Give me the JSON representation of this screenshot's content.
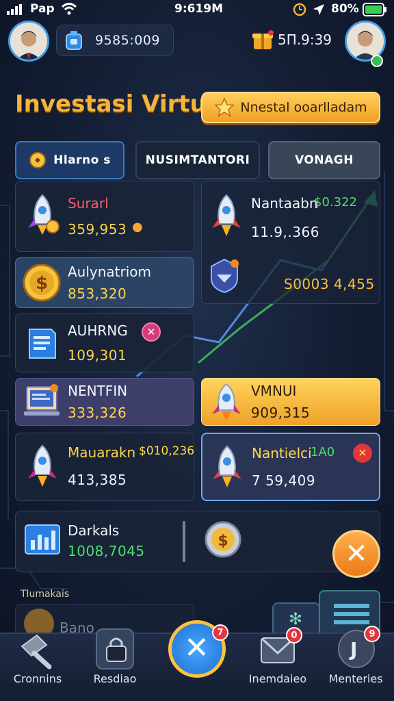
{
  "status_bar": {
    "carrier": "Pap",
    "time": "9:619M",
    "battery": "80%"
  },
  "header": {
    "balance": "9585:009",
    "timer": "5Π.9:39"
  },
  "title": "Investasi Virtual",
  "cta_label": "Nnestal ooarlladam",
  "tabs": [
    {
      "label": "Hlarno s"
    },
    {
      "label": "NUSIMTANTORI"
    },
    {
      "label": "VONAGH"
    }
  ],
  "left_cards": [
    {
      "name": "Surarl",
      "amount": "359,953"
    },
    {
      "name": "Aulynatriom",
      "amount": "853,320"
    },
    {
      "name": "AUHRNG",
      "amount": "109,301"
    },
    {
      "name": "NENTFIN",
      "amount": "333,326"
    },
    {
      "name": "Mauarakn",
      "extra": "$010,236",
      "amount": "413,385"
    }
  ],
  "right_cards": [
    {
      "name": "Nantaabn",
      "extra": "$0.322",
      "amount": "11.9,.366"
    },
    {
      "amount": "S0003 4,455"
    },
    {
      "name": "VMNUI",
      "amount": "909,315"
    },
    {
      "name": "Nantielci",
      "extra": "1A0",
      "amount": "7 59,409"
    }
  ],
  "wide_card": {
    "name": "Darkals",
    "amount": "1008,7045"
  },
  "section_label": "Tlumakais",
  "section_item": "Bano",
  "nav": [
    {
      "label": "Cronnins"
    },
    {
      "label": "Resdiao"
    },
    {
      "label": "",
      "badge": "7"
    },
    {
      "label": "Inemdaieo",
      "badge": "0"
    },
    {
      "label": "Menteries",
      "badge": "9"
    }
  ],
  "colors": {
    "accent_gold": "#f4b43a",
    "accent_blue": "#3c79c6",
    "positive_green": "#4ee06a"
  }
}
